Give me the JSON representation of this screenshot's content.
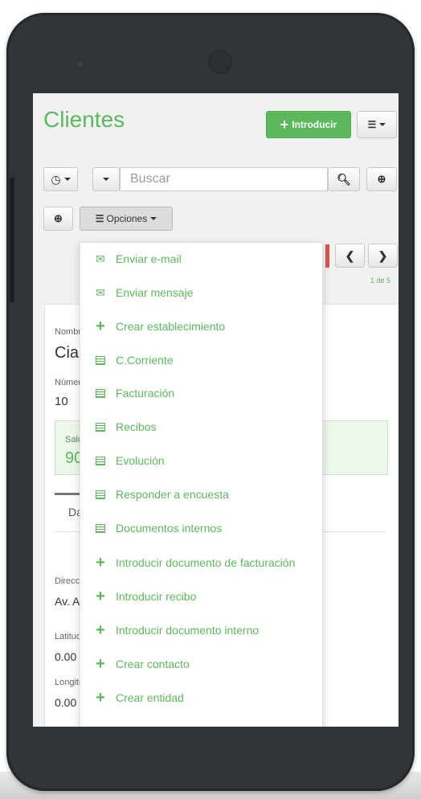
{
  "page": {
    "title": "Clientes",
    "introducir_label": "Introducir"
  },
  "toolbar": {
    "search_placeholder": "Buscar",
    "opciones_label": "Opciones"
  },
  "pagination": {
    "info": "1 de 5"
  },
  "card": {
    "nombre_label": "Nombre",
    "nombre_value": "Cia",
    "numero_label": "Número",
    "numero_value": "10",
    "saldo_label": "Saldo",
    "saldo_value": "90",
    "tab_label": "Datos",
    "direccion_label": "Dirección",
    "direccion_value": "Av. A",
    "latitud_label": "Latitud",
    "latitud_value": "0.00",
    "longitud_label": "Longitud",
    "longitud_value": "0.00"
  },
  "menu": {
    "items": [
      {
        "label": "Enviar e-mail",
        "icon": "envelope-outline-icon"
      },
      {
        "label": "Enviar mensaje",
        "icon": "envelope-icon"
      },
      {
        "label": "Crear establecimiento",
        "icon": "plus-icon"
      },
      {
        "label": "C.Corriente",
        "icon": "table-icon"
      },
      {
        "label": "Facturación",
        "icon": "table-icon"
      },
      {
        "label": "Recibos",
        "icon": "table-icon"
      },
      {
        "label": "Evolución",
        "icon": "table-icon"
      },
      {
        "label": "Responder a encuesta",
        "icon": "table-icon"
      },
      {
        "label": "Documentos internos",
        "icon": "table-icon"
      },
      {
        "label": "Introducir documento de facturación",
        "icon": "plus-icon"
      },
      {
        "label": "Introducir recibo",
        "icon": "plus-icon"
      },
      {
        "label": "Introducir documento interno",
        "icon": "plus-icon"
      },
      {
        "label": "Crear contacto",
        "icon": "plus-icon"
      },
      {
        "label": "Crear entidad",
        "icon": "plus-icon"
      }
    ]
  },
  "colors": {
    "accent": "#5cb85c",
    "phone_body": "#2f3538",
    "alert": "#d9534f"
  }
}
